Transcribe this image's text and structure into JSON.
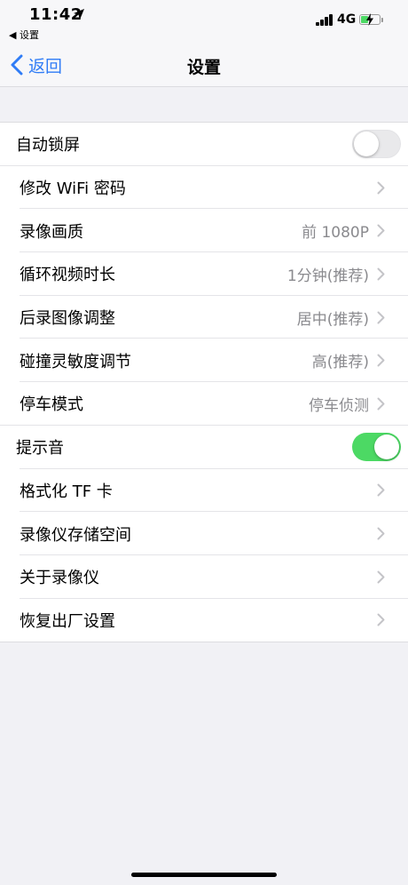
{
  "status_bar": {
    "time": "11:42",
    "back_app": "◀ 设置",
    "network": "4G"
  },
  "nav": {
    "back_label": "返回",
    "title": "设置"
  },
  "settings": [
    {
      "label": "自动锁屏",
      "kind": "toggle",
      "on": false
    },
    {
      "label": "修改 WiFi 密码",
      "kind": "link",
      "value": ""
    },
    {
      "label": "录像画质",
      "kind": "link",
      "value": "前 1080P"
    },
    {
      "label": "循环视频时长",
      "kind": "link",
      "value": "1分钟(推荐)"
    },
    {
      "label": "后录图像调整",
      "kind": "link",
      "value": "居中(推荐)"
    },
    {
      "label": "碰撞灵敏度调节",
      "kind": "link",
      "value": "高(推荐)"
    },
    {
      "label": "停车模式",
      "kind": "link",
      "value": "停车侦测"
    },
    {
      "label": "提示音",
      "kind": "toggle",
      "on": true
    },
    {
      "label": "格式化 TF 卡",
      "kind": "link",
      "value": ""
    },
    {
      "label": "录像仪存储空间",
      "kind": "link",
      "value": ""
    },
    {
      "label": "关于录像仪",
      "kind": "link",
      "value": ""
    },
    {
      "label": "恢复出厂设置",
      "kind": "link",
      "value": ""
    }
  ],
  "colors": {
    "accent": "#2f7cf6",
    "toggle_on": "#4cd964",
    "background": "#f1f1f5"
  }
}
